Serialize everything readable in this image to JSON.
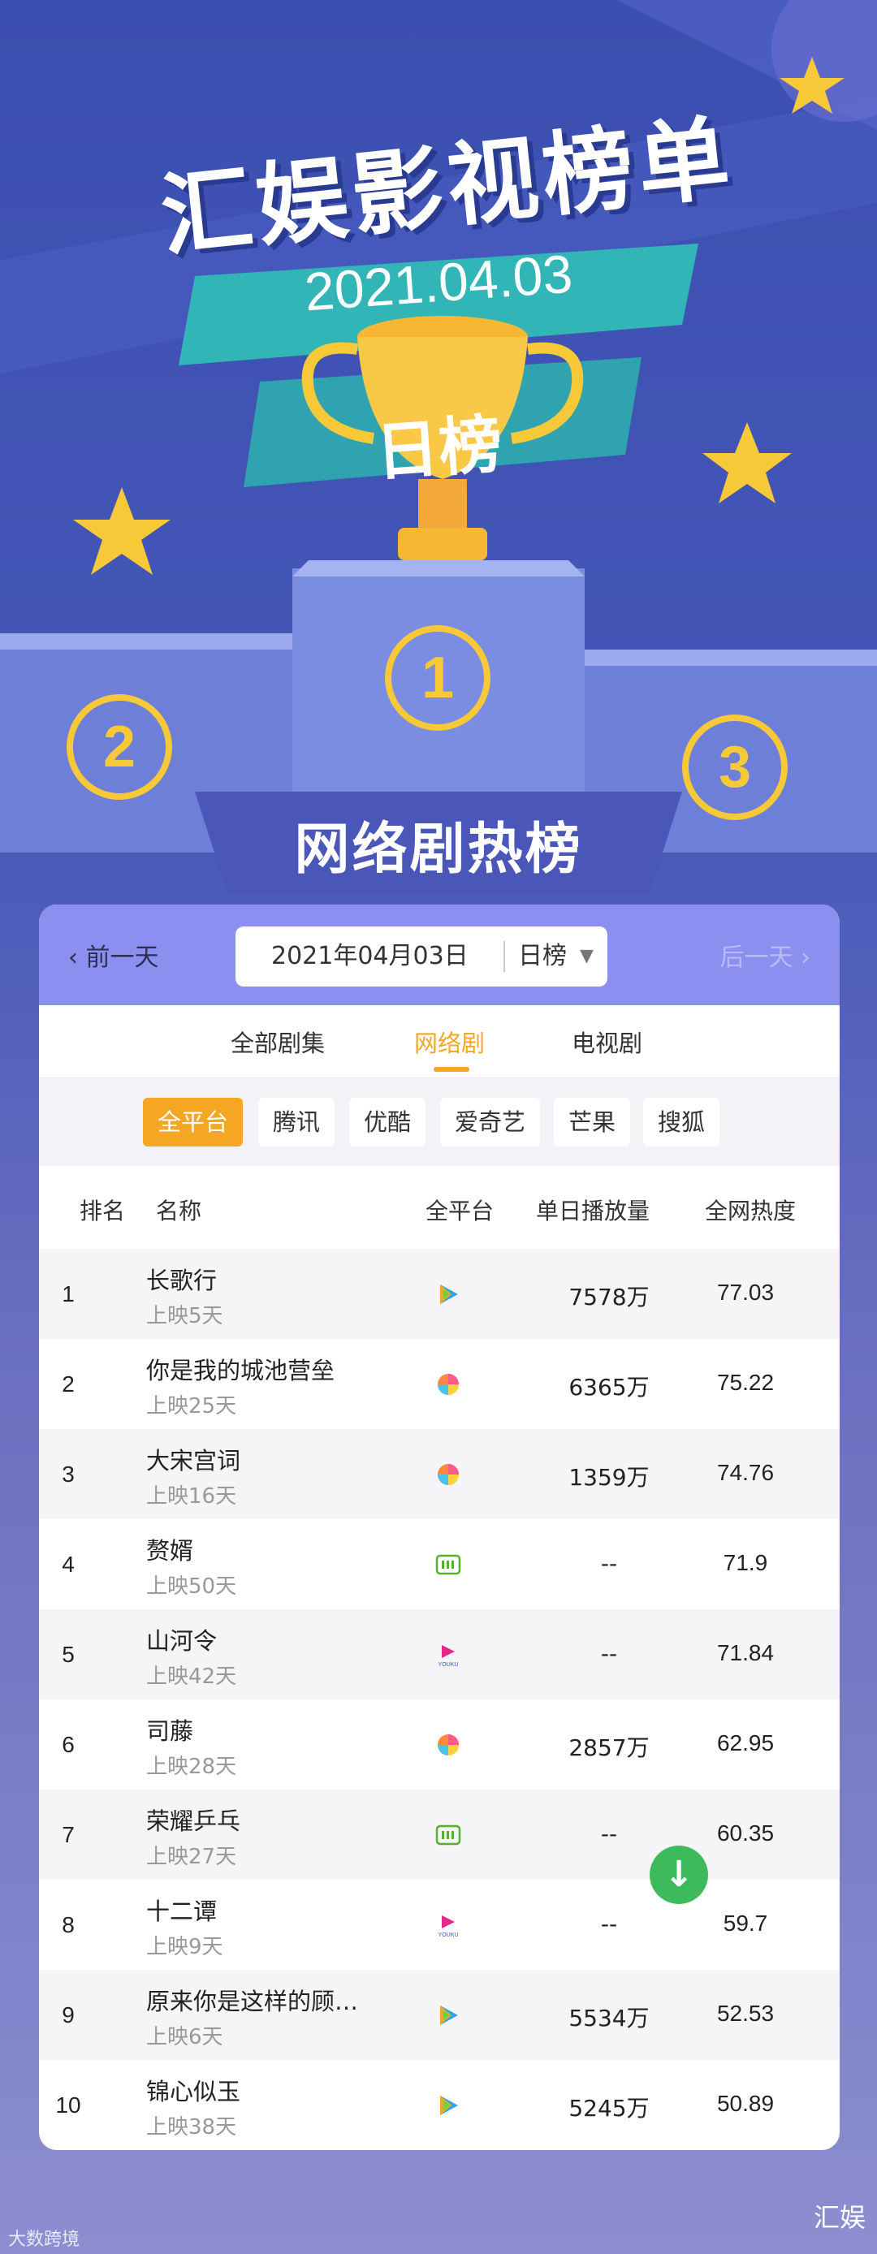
{
  "header": {
    "title": "汇娱影视榜单",
    "date": "2021.04.03",
    "period": "日榜",
    "podium": [
      "1",
      "2",
      "3"
    ],
    "section_title": "网络剧热榜"
  },
  "datebar": {
    "prev": "前一天",
    "date": "2021年04月03日",
    "type": "日榜",
    "next": "后一天"
  },
  "tabs": [
    {
      "label": "全部剧集",
      "active": false
    },
    {
      "label": "网络剧",
      "active": true
    },
    {
      "label": "电视剧",
      "active": false
    }
  ],
  "platforms": [
    {
      "label": "全平台",
      "active": true
    },
    {
      "label": "腾讯",
      "active": false
    },
    {
      "label": "优酷",
      "active": false
    },
    {
      "label": "爱奇艺",
      "active": false
    },
    {
      "label": "芒果",
      "active": false
    },
    {
      "label": "搜狐",
      "active": false
    }
  ],
  "table": {
    "headers": {
      "rank": "排名",
      "name": "名称",
      "platform": "全平台",
      "plays": "单日播放量",
      "heat": "全网热度"
    },
    "rows": [
      {
        "rank": "1",
        "name": "长歌行",
        "days": "上映5天",
        "platform_icon": "tencent-video-icon",
        "plays": "7578万",
        "heat": "77.03"
      },
      {
        "rank": "2",
        "name": "你是我的城池营垒",
        "days": "上映25天",
        "platform_icon": "mango-tv-icon",
        "plays": "6365万",
        "heat": "75.22"
      },
      {
        "rank": "3",
        "name": "大宋宫词",
        "days": "上映16天",
        "platform_icon": "mango-tv-icon",
        "plays": "1359万",
        "heat": "74.76"
      },
      {
        "rank": "4",
        "name": "赘婿",
        "days": "上映50天",
        "platform_icon": "iqiyi-icon",
        "plays": "--",
        "heat": "71.9"
      },
      {
        "rank": "5",
        "name": "山河令",
        "days": "上映42天",
        "platform_icon": "youku-icon",
        "plays": "--",
        "heat": "71.84"
      },
      {
        "rank": "6",
        "name": "司藤",
        "days": "上映28天",
        "platform_icon": "mango-tv-icon",
        "plays": "2857万",
        "heat": "62.95"
      },
      {
        "rank": "7",
        "name": "荣耀乒乓",
        "days": "上映27天",
        "platform_icon": "iqiyi-icon",
        "plays": "--",
        "heat": "60.35"
      },
      {
        "rank": "8",
        "name": "十二谭",
        "days": "上映9天",
        "platform_icon": "youku-icon",
        "plays": "--",
        "heat": "59.7"
      },
      {
        "rank": "9",
        "name": " 原来你是这样的顾…",
        "days": "上映6天",
        "platform_icon": "tencent-video-icon",
        "plays": "5534万",
        "heat": "52.53"
      },
      {
        "rank": "10",
        "name": "锦心似玉",
        "days": "上映38天",
        "platform_icon": "tencent-video-icon",
        "plays": "5245万",
        "heat": "50.89"
      }
    ]
  },
  "footer": {
    "left": "大数跨境",
    "right": "汇娱"
  },
  "colors": {
    "accent": "#f5a623",
    "datebar": "#8b8ff0",
    "background": "#3b4fb0"
  }
}
